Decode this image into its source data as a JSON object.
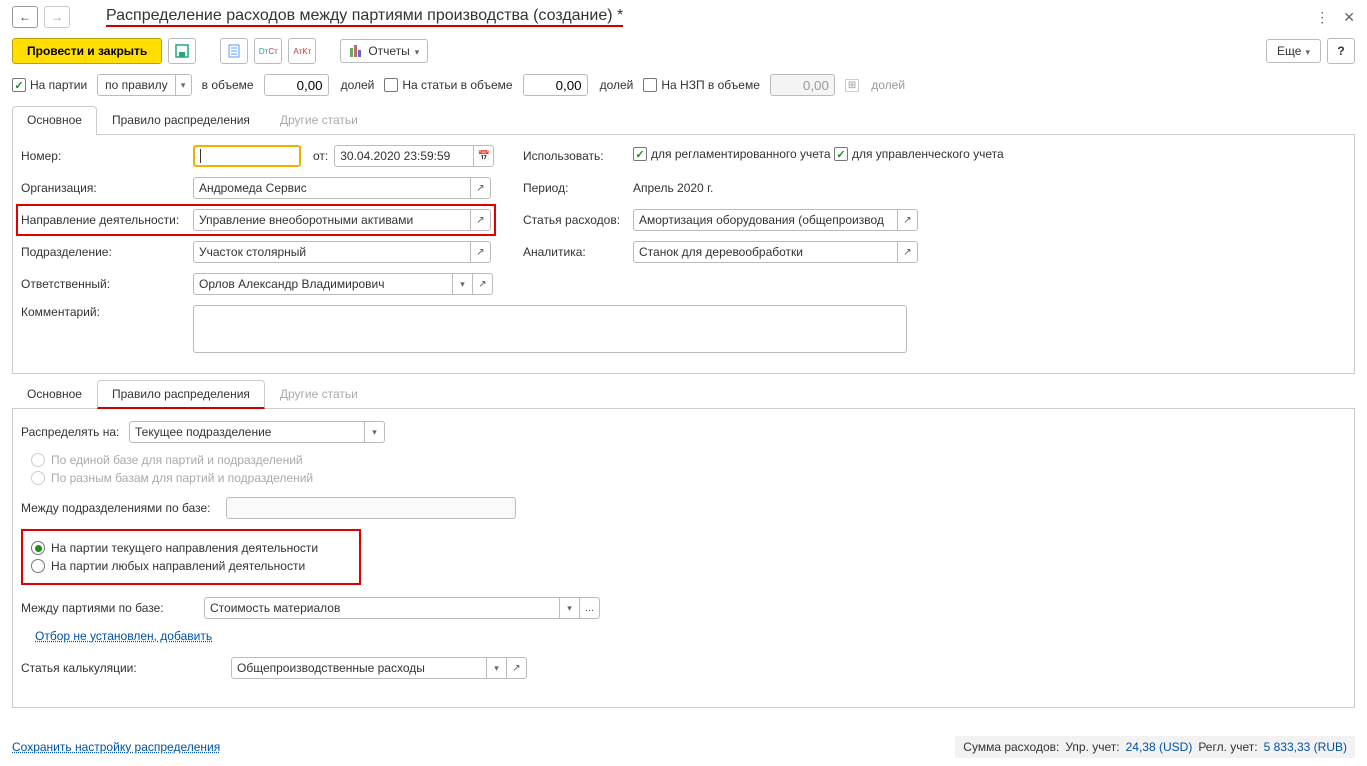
{
  "nav": {
    "back": "←",
    "forward": "→"
  },
  "title": "Распределение расходов между партиями производства (создание) *",
  "toolbar": {
    "post_close": "Провести и закрыть",
    "reports": "Отчеты",
    "more": "Еще",
    "help": "?"
  },
  "options": {
    "on_batches": "На партии",
    "rule_select": "по правилу",
    "in_volume": "в объеме",
    "vol1": "0,00",
    "unit": "долей",
    "on_articles": "На статьи в объеме",
    "vol2": "0,00",
    "on_wip": "На НЗП в объеме",
    "vol3": "0,00"
  },
  "tabs": [
    "Основное",
    "Правило распределения",
    "Другие статьи"
  ],
  "form": {
    "number_lbl": "Номер:",
    "number": "",
    "from_lbl": "от:",
    "date": "30.04.2020 23:59:59",
    "use_lbl": "Использовать:",
    "use_reg": "для регламентированного учета",
    "use_mgmt": "для управленческого учета",
    "org_lbl": "Организация:",
    "org": "Андромеда Сервис",
    "period_lbl": "Период:",
    "period": "Апрель 2020 г.",
    "dir_lbl": "Направление деятельности:",
    "dir": "Управление внеоборотными активами",
    "article_lbl": "Статья расходов:",
    "article": "Амортизация оборудования (общепроизвод",
    "dept_lbl": "Подразделение:",
    "dept": "Участок столярный",
    "analytic_lbl": "Аналитика:",
    "analytic": "Станок для деревообработки",
    "resp_lbl": "Ответственный:",
    "resp": "Орлов Александр Владимирович",
    "comment_lbl": "Комментарий:"
  },
  "rule": {
    "distribute_lbl": "Распределять на:",
    "distribute_val": "Текущее подразделение",
    "radio1": "По единой базе для партий и подразделений",
    "radio2": "По разным базам для партий и подразделений",
    "between_depts_lbl": "Между подразделениями по базе:",
    "radio3": "На партии текущего направления деятельности",
    "radio4": "На партии любых направлений деятельности",
    "between_batches_lbl": "Между партиями по базе:",
    "between_batches_val": "Стоимость материалов",
    "filter_link": "Отбор не установлен, добавить",
    "calc_article_lbl": "Статья калькуляции:",
    "calc_article_val": "Общепроизводственные расходы"
  },
  "save_link": "Сохранить настройку распределения",
  "footer": {
    "sum_lbl": "Сумма расходов:",
    "mgmt_lbl": "Упр. учет:",
    "mgmt_val": "24,38 (USD)",
    "reg_lbl": "Регл. учет:",
    "reg_val": "5 833,33 (RUB)"
  }
}
